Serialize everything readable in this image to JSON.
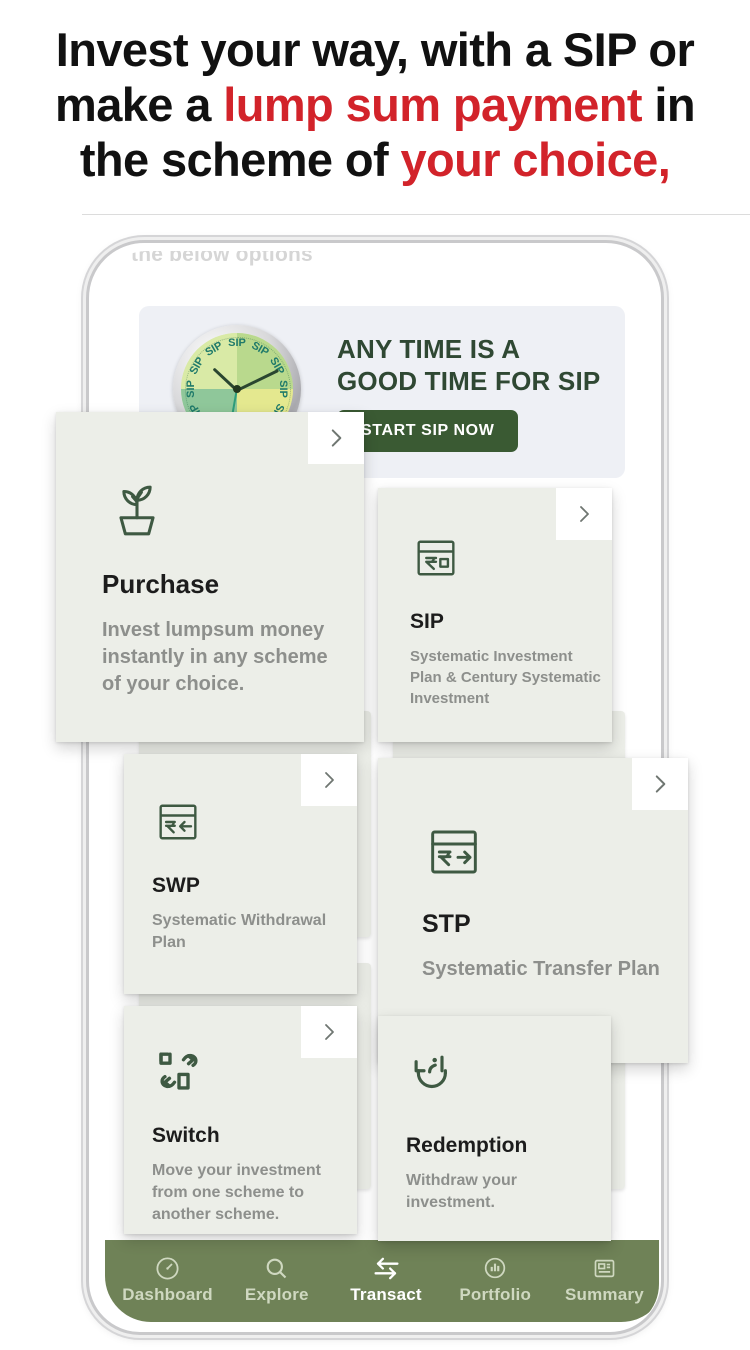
{
  "headline": {
    "line1_a": "Invest your way, with a SIP or",
    "line2_a": "make a ",
    "line2_red": "lump sum payment",
    "line2_b": " in",
    "line3_a": "the scheme of ",
    "line3_red": "your choice,",
    "accent_color": "#d2232a"
  },
  "phone": {
    "screen_cut_text": "the below options",
    "banner": {
      "title_line1": "ANY TIME IS A",
      "title_line2": "GOOD TIME FOR SIP",
      "button_label": "START SIP NOW",
      "clock_tick_label": "SIP",
      "button_color": "#3a5a33",
      "background_color": "#eef0f5"
    },
    "chevron_label": "›",
    "cards": [
      {
        "id": "purchase",
        "title": "Purchase",
        "desc": "Invest lumpsum money instantly in any scheme of your choice.",
        "icon": "plant-sprout-icon"
      },
      {
        "id": "sip",
        "title": "SIP",
        "desc": "Systematic Investment Plan & Century Systematic Investment",
        "icon": "rupee-calendar-icon"
      },
      {
        "id": "swp",
        "title": "SWP",
        "desc": "Systematic Withdrawal Plan",
        "icon": "rupee-arrow-left-icon"
      },
      {
        "id": "stp",
        "title": "STP",
        "desc": "Systematic Transfer Plan",
        "icon": "rupee-arrow-right-icon"
      },
      {
        "id": "switch",
        "title": "Switch",
        "desc": "Move your investment from one scheme to another scheme.",
        "icon": "switch-arrows-icon"
      },
      {
        "id": "redemption",
        "title": "Redemption",
        "desc": "Withdraw your investment.",
        "icon": "redeem-money-icon"
      }
    ],
    "bottom_nav": {
      "active": "Transact",
      "bar_color": "#6f8257",
      "items": [
        {
          "label": "Dashboard",
          "icon": "speedometer-icon"
        },
        {
          "label": "Explore",
          "icon": "search-icon"
        },
        {
          "label": "Transact",
          "icon": "transfer-arrows-icon"
        },
        {
          "label": "Portfolio",
          "icon": "bar-chart-icon"
        },
        {
          "label": "Summary",
          "icon": "newspaper-icon"
        }
      ]
    }
  },
  "theme": {
    "card_bg": "#eceee8",
    "icon_green": "#3e5942",
    "title_color": "#1c1c1c",
    "desc_color": "#8d8f8c"
  }
}
